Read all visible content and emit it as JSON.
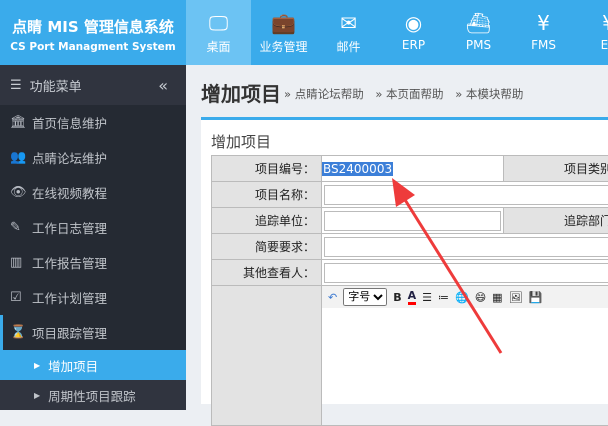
{
  "brand": {
    "title": "点睛 MIS 管理信息系统",
    "subtitle": "CS Port Managment System"
  },
  "nav": [
    {
      "label": "桌面",
      "icon": "monitor-icon"
    },
    {
      "label": "业务管理",
      "icon": "briefcase-icon"
    },
    {
      "label": "邮件",
      "icon": "envelope-icon"
    },
    {
      "label": "ERP",
      "icon": "chrome-icon"
    },
    {
      "label": "PMS",
      "icon": "ship-icon"
    },
    {
      "label": "FMS",
      "icon": "yen-icon"
    },
    {
      "label": "EB",
      "icon": "yen-icon"
    }
  ],
  "sidebar": {
    "header": "功能菜单",
    "items": [
      "首页信息维护",
      "点睛论坛维护",
      "在线视频教程",
      "工作日志管理",
      "工作报告管理",
      "工作计划管理",
      "项目跟踪管理"
    ],
    "subitems": [
      "增加项目",
      "周期性项目跟踪"
    ]
  },
  "page": {
    "title": "增加项目",
    "crumbs": [
      "» 点睛论坛帮助",
      "» 本页面帮助",
      "» 本模块帮助"
    ],
    "panel_title": "增加项目"
  },
  "form": {
    "code_label": "项目编号：",
    "code_value": "BS2400003",
    "type_label": "项目类别：",
    "name_label": "项目名称：",
    "unit_label": "追踪单位：",
    "dept_label": "追踪部门：",
    "req_label": "简要要求：",
    "viewer_label": "其他查看人：",
    "font_size_option": "字号"
  }
}
